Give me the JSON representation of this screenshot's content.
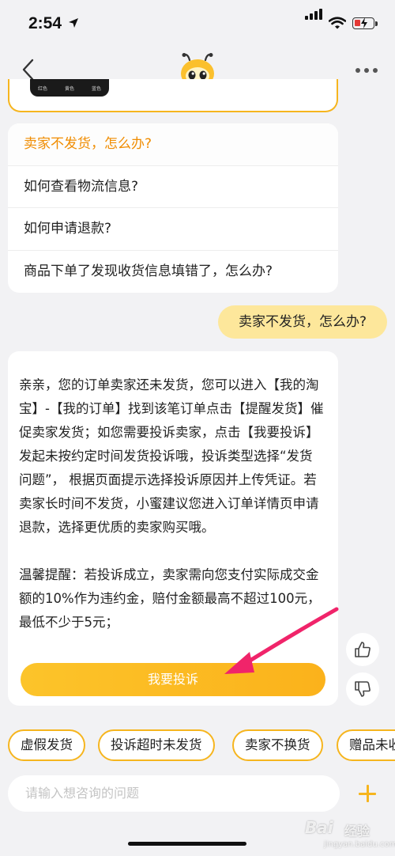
{
  "status_bar": {
    "time": "2:54"
  },
  "nav": {
    "back_icon": "chevron-left-icon",
    "avatar_icon": "bee-mascot-icon",
    "more_icon": "ellipsis-icon"
  },
  "previous_card": {
    "swatch_labels": [
      "红色",
      "黄色",
      "蓝色"
    ]
  },
  "faq": {
    "items": [
      {
        "label": "卖家不发货，怎么办?",
        "active": true
      },
      {
        "label": "如何查看物流信息?",
        "active": false
      },
      {
        "label": "如何申请退款?",
        "active": false
      },
      {
        "label": "商品下单了发现收货信息填错了，怎么办?",
        "active": false
      }
    ]
  },
  "user_message": "卖家不发货，怎么办?",
  "answer": {
    "paragraph1": "亲亲，您的订单卖家还未发货，您可以进入【我的淘宝】-【我的订单】找到该笔订单点击【提醒发货】催促卖家发货；如您需要投诉卖家，点击【我要投诉】发起未按约定时间发货投诉哦，投诉类型选择“发货问题”， 根据页面提示选择投诉原因并上传凭证。若卖家长时间不发货，小蜜建议您进入订单详情页申请退款，选择更优质的卖家购买哦。",
    "paragraph2": "温馨提醒：若投诉成立，卖家需向您支付实际成交金额的10%作为违约金，赔付金额最高不超过100元，最低不少于5元；",
    "button_label": "我要投诉"
  },
  "feedback": {
    "like_icon": "thumbs-up-icon",
    "dislike_icon": "thumbs-down-icon"
  },
  "quick_chips": [
    "虚假发货",
    "投诉超时未发货",
    "卖家不换货",
    "赠品未收到"
  ],
  "input": {
    "placeholder": "请输入想咨询的问题"
  },
  "watermark": {
    "logo": "Bai",
    "logo_cn": "经验",
    "url": "jingyan.baidu.com"
  },
  "colors": {
    "accent": "#f6b51e",
    "active_text": "#f08c00",
    "user_bubble": "#fde79b",
    "annotation_arrow": "#f0246a"
  }
}
